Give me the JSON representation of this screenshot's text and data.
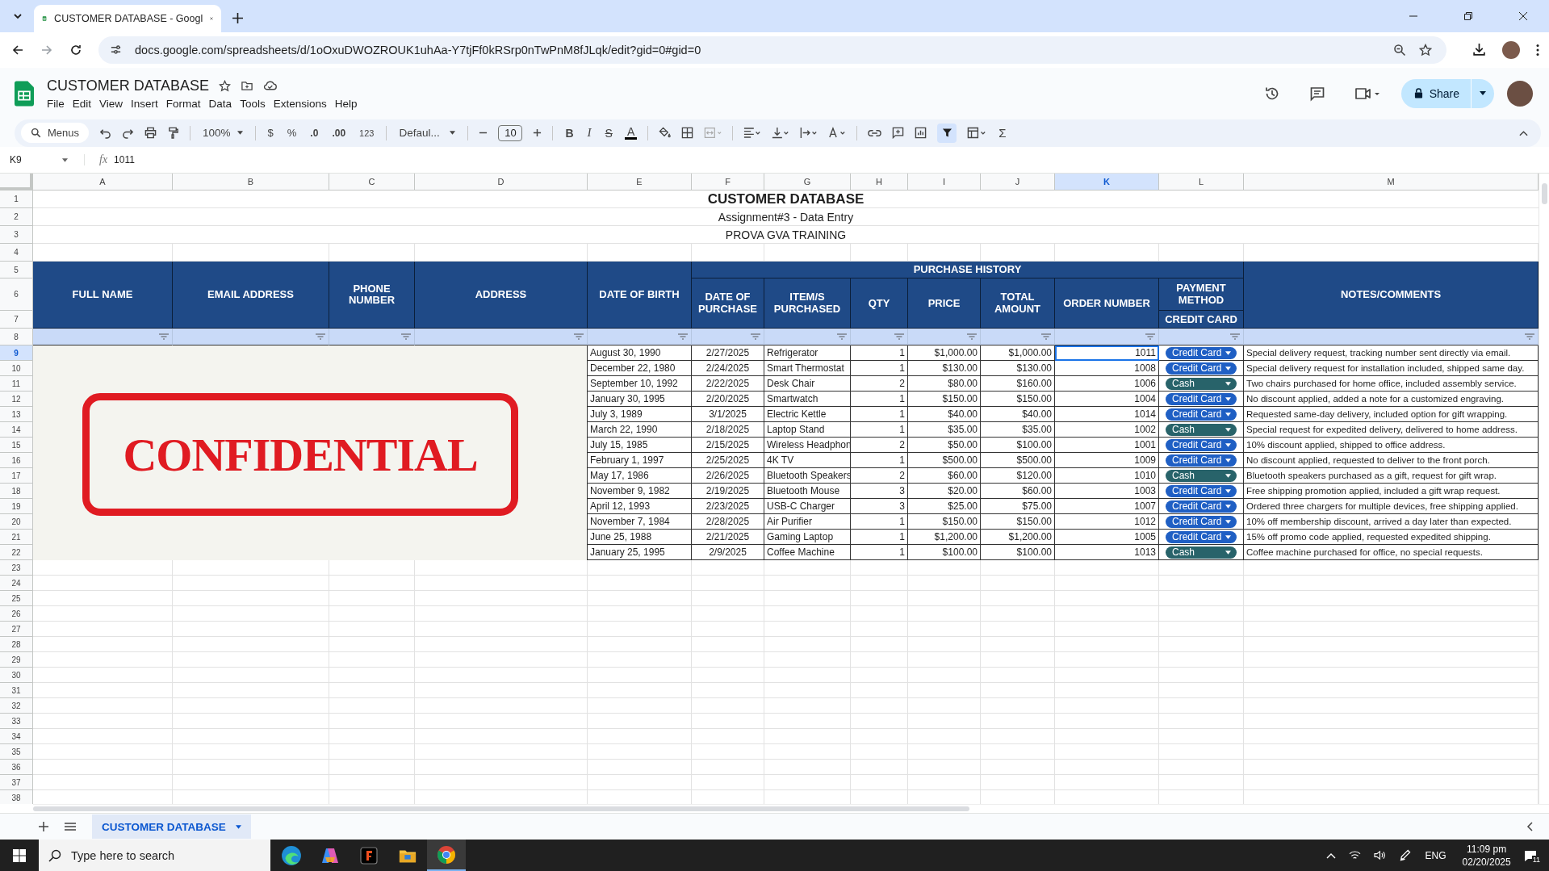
{
  "browser": {
    "tab_title": "CUSTOMER DATABASE - Googl",
    "url": "docs.google.com/spreadsheets/d/1oOxuDWOZROUK1uhAa-Y7tjFf0kRSrp0nTwPnM8fJLqk/edit?gid=0#gid=0"
  },
  "doc": {
    "title": "CUSTOMER DATABASE",
    "menu": [
      "File",
      "Edit",
      "View",
      "Insert",
      "Format",
      "Data",
      "Tools",
      "Extensions",
      "Help"
    ],
    "share": "Share"
  },
  "toolbar": {
    "search": "Menus",
    "zoom": "100%",
    "currency": "$",
    "percent": "%",
    "dec_less": ".0",
    "dec_more": ".00",
    "number_format": "123",
    "font": "Defaul...",
    "font_size": "10",
    "bold": "B",
    "italic": "I",
    "strike": "S",
    "text_color": "A",
    "sum": "Σ",
    "filter_active": true
  },
  "formula_bar": {
    "cell": "K9",
    "fx": "fx",
    "value": "1011"
  },
  "sheet": {
    "columns": [
      {
        "letter": "A",
        "selected": false
      },
      {
        "letter": "B",
        "selected": false
      },
      {
        "letter": "C",
        "selected": false
      },
      {
        "letter": "D",
        "selected": false
      },
      {
        "letter": "E",
        "selected": false
      },
      {
        "letter": "F",
        "selected": false
      },
      {
        "letter": "G",
        "selected": false
      },
      {
        "letter": "H",
        "selected": false
      },
      {
        "letter": "I",
        "selected": false
      },
      {
        "letter": "J",
        "selected": false
      },
      {
        "letter": "K",
        "selected": true
      },
      {
        "letter": "L",
        "selected": false
      },
      {
        "letter": "M",
        "selected": false
      }
    ],
    "rows": [
      {
        "number": "1",
        "selected": false
      },
      {
        "number": "2",
        "selected": false
      },
      {
        "number": "3",
        "selected": false
      },
      {
        "number": "4",
        "selected": false
      },
      {
        "number": "5",
        "selected": false
      },
      {
        "number": "6",
        "selected": false
      },
      {
        "number": "7",
        "selected": false
      },
      {
        "number": "8",
        "selected": false
      },
      {
        "number": "9",
        "selected": true
      },
      {
        "number": "10",
        "selected": false
      },
      {
        "number": "11",
        "selected": false
      },
      {
        "number": "12",
        "selected": false
      },
      {
        "number": "13",
        "selected": false
      },
      {
        "number": "14",
        "selected": false
      },
      {
        "number": "15",
        "selected": false
      },
      {
        "number": "16",
        "selected": false
      },
      {
        "number": "17",
        "selected": false
      },
      {
        "number": "18",
        "selected": false
      },
      {
        "number": "19",
        "selected": false
      },
      {
        "number": "20",
        "selected": false
      },
      {
        "number": "21",
        "selected": false
      },
      {
        "number": "22",
        "selected": false
      },
      {
        "number": "23",
        "selected": false
      },
      {
        "number": "24",
        "selected": false
      },
      {
        "number": "25",
        "selected": false
      },
      {
        "number": "26",
        "selected": false
      },
      {
        "number": "27",
        "selected": false
      },
      {
        "number": "28",
        "selected": false
      },
      {
        "number": "29",
        "selected": false
      },
      {
        "number": "30",
        "selected": false
      },
      {
        "number": "31",
        "selected": false
      },
      {
        "number": "32",
        "selected": false
      },
      {
        "number": "33",
        "selected": false
      },
      {
        "number": "34",
        "selected": false
      },
      {
        "number": "35",
        "selected": false
      },
      {
        "number": "36",
        "selected": false
      },
      {
        "number": "37",
        "selected": false
      },
      {
        "number": "38",
        "selected": false
      }
    ],
    "title": "CUSTOMER DATABASE",
    "subtitle": "Assignment#3 - Data Entry",
    "organization": "PROVA GVA TRAINING",
    "headers": {
      "full_name": "FULL NAME",
      "email": "EMAIL ADDRESS",
      "phone": "PHONE NUMBER",
      "address": "ADDRESS",
      "dob": "DATE OF BIRTH",
      "purchase_history": "PURCHASE HISTORY",
      "date_of_purchase": "DATE OF PURCHASE",
      "items": "ITEM/S PURCHASED",
      "qty": "QTY",
      "price": "PRICE",
      "total": "TOTAL AMOUNT",
      "order_number": "ORDER NUMBER",
      "payment_method": "PAYMENT METHOD",
      "payment_sub": "CREDIT CARD",
      "notes": "NOTES/COMMENTS"
    },
    "stamp": "CONFIDENTIAL",
    "records": [
      {
        "dob": "August 30, 1990",
        "date": "2/27/2025",
        "item": "Refrigerator",
        "qty": "1",
        "price": "$1,000.00",
        "total": "$1,000.00",
        "order": "1011",
        "selected": true,
        "payment": {
          "label": "Credit Card",
          "color": "#1f5fc4"
        },
        "notes": "Special delivery request, tracking number sent directly via email."
      },
      {
        "dob": "December 22, 1980",
        "date": "2/24/2025",
        "item": "Smart Thermostat",
        "qty": "1",
        "price": "$130.00",
        "total": "$130.00",
        "order": "1008",
        "selected": false,
        "payment": {
          "label": "Credit Card",
          "color": "#1f5fc4"
        },
        "notes": "Special delivery request for installation included, shipped same day."
      },
      {
        "dob": "September 10, 1992",
        "date": "2/22/2025",
        "item": "Desk Chair",
        "qty": "2",
        "price": "$80.00",
        "total": "$160.00",
        "order": "1006",
        "selected": false,
        "payment": {
          "label": "Cash",
          "color": "#28636a"
        },
        "notes": "Two chairs purchased for home office, included assembly service."
      },
      {
        "dob": "January 30, 1995",
        "date": "2/20/2025",
        "item": "Smartwatch",
        "qty": "1",
        "price": "$150.00",
        "total": "$150.00",
        "order": "1004",
        "selected": false,
        "payment": {
          "label": "Credit Card",
          "color": "#1f5fc4"
        },
        "notes": "No discount applied, added a note for a customized engraving."
      },
      {
        "dob": "July 3, 1989",
        "date": "3/1/2025",
        "item": "Electric Kettle",
        "qty": "1",
        "price": "$40.00",
        "total": "$40.00",
        "order": "1014",
        "selected": false,
        "payment": {
          "label": "Credit Card",
          "color": "#1f5fc4"
        },
        "notes": "Requested same-day delivery, included option for gift wrapping."
      },
      {
        "dob": "March 22, 1990",
        "date": "2/18/2025",
        "item": "Laptop Stand",
        "qty": "1",
        "price": "$35.00",
        "total": "$35.00",
        "order": "1002",
        "selected": false,
        "payment": {
          "label": "Cash",
          "color": "#28636a"
        },
        "notes": "Special request for expedited delivery, delivered to home address."
      },
      {
        "dob": "July 15, 1985",
        "date": "2/15/2025",
        "item": "Wireless Headphon",
        "qty": "2",
        "price": "$50.00",
        "total": "$100.00",
        "order": "1001",
        "selected": false,
        "payment": {
          "label": "Credit Card",
          "color": "#1f5fc4"
        },
        "notes": "10% discount applied, shipped to office address."
      },
      {
        "dob": "February 1, 1997",
        "date": "2/25/2025",
        "item": "4K TV",
        "qty": "1",
        "price": "$500.00",
        "total": "$500.00",
        "order": "1009",
        "selected": false,
        "payment": {
          "label": "Credit Card",
          "color": "#1f5fc4"
        },
        "notes": "No discount applied, requested to deliver to the front porch."
      },
      {
        "dob": "May 17, 1986",
        "date": "2/26/2025",
        "item": "Bluetooth Speakers",
        "qty": "2",
        "price": "$60.00",
        "total": "$120.00",
        "order": "1010",
        "selected": false,
        "payment": {
          "label": "Cash",
          "color": "#28636a"
        },
        "notes": "Bluetooth speakers purchased as a gift, request for gift wrap."
      },
      {
        "dob": "November 9, 1982",
        "date": "2/19/2025",
        "item": "Bluetooth Mouse",
        "qty": "3",
        "price": "$20.00",
        "total": "$60.00",
        "order": "1003",
        "selected": false,
        "payment": {
          "label": "Credit Card",
          "color": "#1f5fc4"
        },
        "notes": "Free shipping promotion applied, included a gift wrap request."
      },
      {
        "dob": "April 12, 1993",
        "date": "2/23/2025",
        "item": "USB-C Charger",
        "qty": "3",
        "price": "$25.00",
        "total": "$75.00",
        "order": "1007",
        "selected": false,
        "payment": {
          "label": "Credit Card",
          "color": "#1f5fc4"
        },
        "notes": "Ordered three chargers for multiple devices, free shipping applied."
      },
      {
        "dob": "November 7, 1984",
        "date": "2/28/2025",
        "item": "Air Purifier",
        "qty": "1",
        "price": "$150.00",
        "total": "$150.00",
        "order": "1012",
        "selected": false,
        "payment": {
          "label": "Credit Card",
          "color": "#1f5fc4"
        },
        "notes": "10% off membership discount, arrived a day later than expected."
      },
      {
        "dob": "June 25, 1988",
        "date": "2/21/2025",
        "item": "Gaming Laptop",
        "qty": "1",
        "price": "$1,200.00",
        "total": "$1,200.00",
        "order": "1005",
        "selected": false,
        "payment": {
          "label": "Credit Card",
          "color": "#1f5fc4"
        },
        "notes": "15% off promo code applied, requested expedited shipping."
      },
      {
        "dob": "January 25, 1995",
        "date": "2/9/2025",
        "item": "Coffee Machine",
        "qty": "1",
        "price": "$100.00",
        "total": "$100.00",
        "order": "1013",
        "selected": false,
        "payment": {
          "label": "Cash",
          "color": "#28636a"
        },
        "notes": "Coffee machine purchased for office, no special requests."
      }
    ]
  },
  "sheet_tabs": [
    {
      "label": "CUSTOMER DATABASE",
      "selected": true
    }
  ],
  "taskbar": {
    "search": "Type here to search",
    "language": "ENG",
    "time": "11:09 pm",
    "date": "02/20/2025",
    "notifications": "11"
  }
}
